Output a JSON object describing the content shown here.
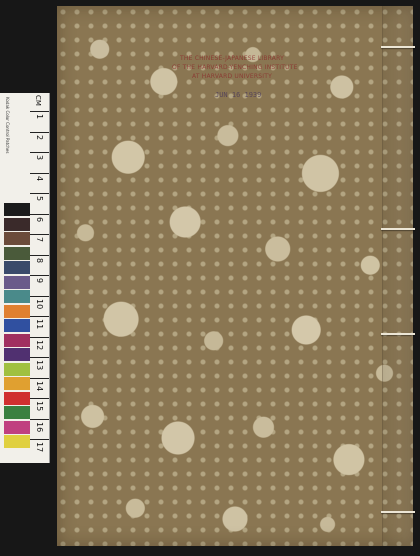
{
  "stamp": {
    "lines": [
      "THE CHINESE-JAPANESE LIBRARY",
      "OF THE HARVARD-YENCHING INSTITUTE",
      "AT HARVARD UNIVERSITY"
    ],
    "date": "JUN 16 1939",
    "color": "#8a2a2a"
  },
  "color_scale": {
    "unit": "CM",
    "label": "Kodak Color Control Patches",
    "numbers": [
      "1",
      "2",
      "3",
      "4",
      "5",
      "6",
      "7",
      "8",
      "9",
      "10",
      "11",
      "12",
      "13",
      "14",
      "15",
      "16",
      "17"
    ],
    "swatches": [
      "#1b1b1b",
      "#3a2a2a",
      "#6b4b3a",
      "#4a5a3a",
      "#3a4a6a",
      "#6a5a8a",
      "#4a8a8a",
      "#e08030",
      "#3050a0",
      "#a03060",
      "#503070",
      "#a0c040",
      "#e0a030",
      "#d03030",
      "#3a8040",
      "#c04080",
      "#e0d040"
    ]
  },
  "cover": {
    "background": "#8a7652",
    "stitches": 4
  }
}
